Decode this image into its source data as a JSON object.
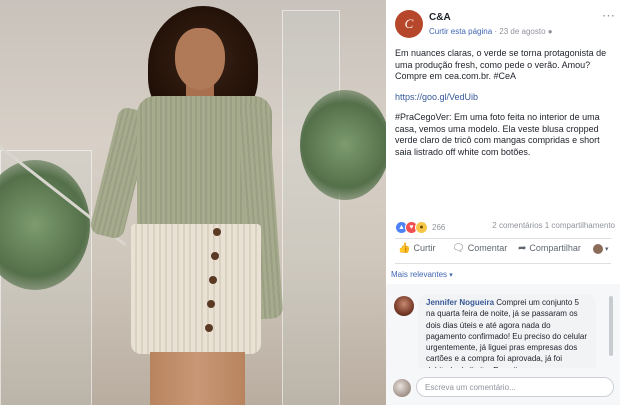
{
  "post": {
    "page_name": "C&A",
    "logo_letter": "C",
    "like_page": "Curtir esta página",
    "date": "23 de agosto",
    "separator": " · ",
    "globe_icon": "globe-icon",
    "paragraph1": "Em nuances claras, o verde se torna protagonista de uma produção fresh, como pede o verão. Amou? Compre em cea.com.br. #CeA",
    "link": "https://goo.gl/VedUib",
    "paragraph3": "#PraCegoVer: Em uma foto feita no interior de uma casa, vemos uma modelo. Ela veste blusa cropped verde claro de tricô com mangas compridas e short saia listrado off white com botões.",
    "reaction_count": "266",
    "counts_text": "2 comentários  1 compartilhamento"
  },
  "actions": {
    "like": "Curtir",
    "comment": "Comentar",
    "share": "Compartilhar"
  },
  "comments": {
    "sort_label": "Mais relevantes",
    "items": [
      {
        "author": "Jennifer Nogueira",
        "text": "Comprei um conjunto 5 na quarta feira de noite, já se passaram os dois dias úteis e até agora nada do pagamento confirmado! Eu preciso do celular urgentemente, já liguei pras empresas dos cartões e a compra foi aprovada, já foi debitado do limite. Eu exijo"
      }
    ],
    "composer_placeholder": "Escreva um comentário..."
  },
  "colors": {
    "brand": "#b7472a",
    "link": "#365899",
    "like_blue": "#4267b2"
  }
}
